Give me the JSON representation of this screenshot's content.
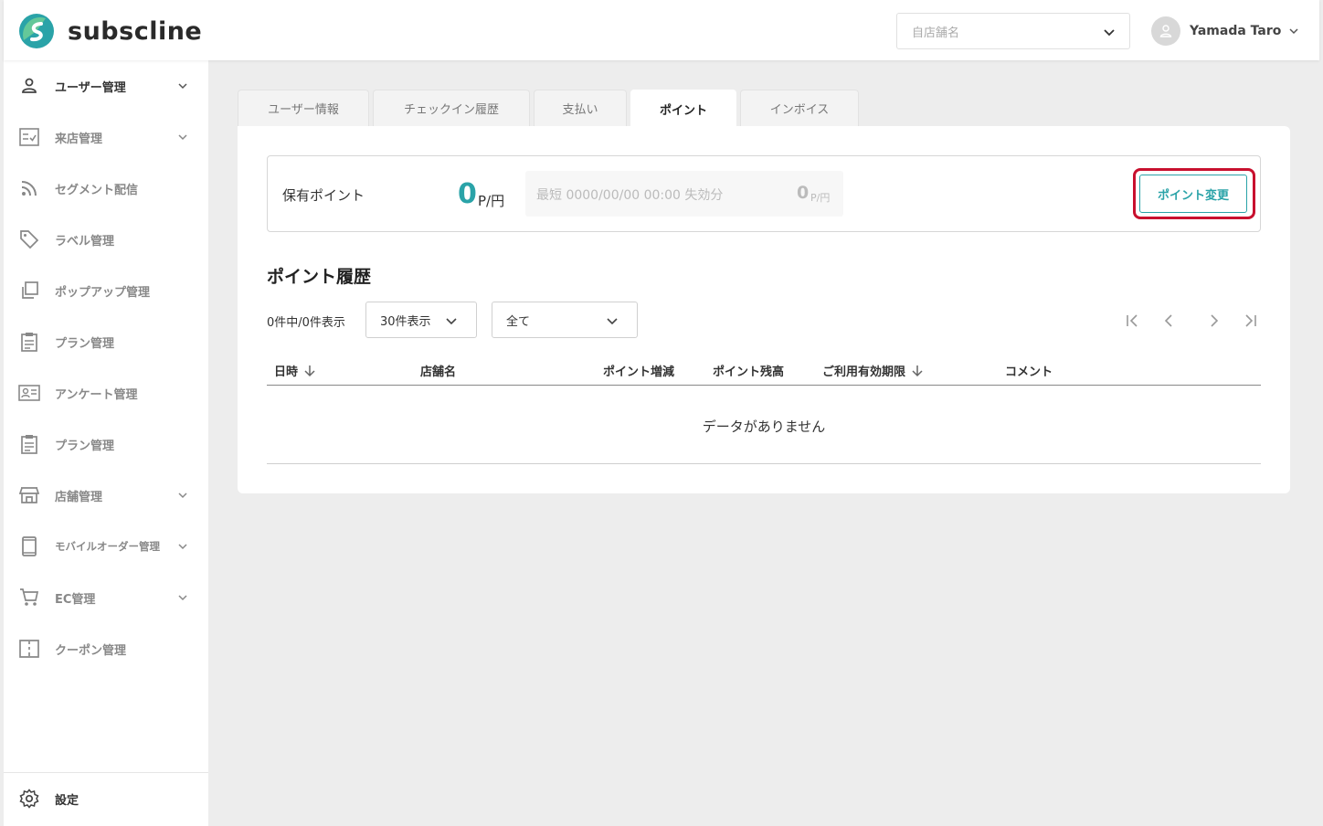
{
  "brand": {
    "name": "subscline",
    "accent": "#2aa3a8",
    "logo_icon": "subscline-logo-icon"
  },
  "header": {
    "store_select_placeholder": "自店舗名",
    "user_name": "Yamada Taro"
  },
  "sidebar": {
    "items": [
      {
        "label": "ユーザー管理",
        "icon": "user-icon",
        "expandable": true,
        "active": true
      },
      {
        "label": "来店管理",
        "icon": "checklist-icon",
        "expandable": true
      },
      {
        "label": "セグメント配信",
        "icon": "rss-icon",
        "expandable": false
      },
      {
        "label": "ラベル管理",
        "icon": "tag-icon",
        "expandable": false
      },
      {
        "label": "ポップアップ管理",
        "icon": "popup-icon",
        "expandable": false
      },
      {
        "label": "プラン管理",
        "icon": "clipboard-icon",
        "expandable": false
      },
      {
        "label": "アンケート管理",
        "icon": "survey-icon",
        "expandable": false
      },
      {
        "label": "プラン管理",
        "icon": "clipboard-icon",
        "expandable": false
      },
      {
        "label": "店舗管理",
        "icon": "store-icon",
        "expandable": true
      },
      {
        "label": "モバイルオーダー管理",
        "icon": "mobile-icon",
        "expandable": true
      },
      {
        "label": "EC管理",
        "icon": "cart-icon",
        "expandable": true
      },
      {
        "label": "クーポン管理",
        "icon": "coupon-icon",
        "expandable": false
      }
    ],
    "settings_label": "設定"
  },
  "tabs": [
    {
      "label": "ユーザー情報",
      "active": false
    },
    {
      "label": "チェックイン履歴",
      "active": false
    },
    {
      "label": "支払い",
      "active": false
    },
    {
      "label": "ポイント",
      "active": true
    },
    {
      "label": "インボイス",
      "active": false
    }
  ],
  "points": {
    "label": "保有ポイント",
    "value": "0",
    "unit": "P/円",
    "expire_text": "最短 0000/00/00 00:00 失効分",
    "expire_value": "0",
    "expire_unit": "P/円",
    "change_button": "ポイント変更"
  },
  "history": {
    "title": "ポイント履歴",
    "count_text": "0件中/0件表示",
    "per_page": "30件表示",
    "filter": "全て",
    "columns": [
      "日時",
      "店舗名",
      "ポイント増減",
      "ポイント残高",
      "ご利用有効期限",
      "コメント"
    ],
    "empty_text": "データがありません"
  }
}
